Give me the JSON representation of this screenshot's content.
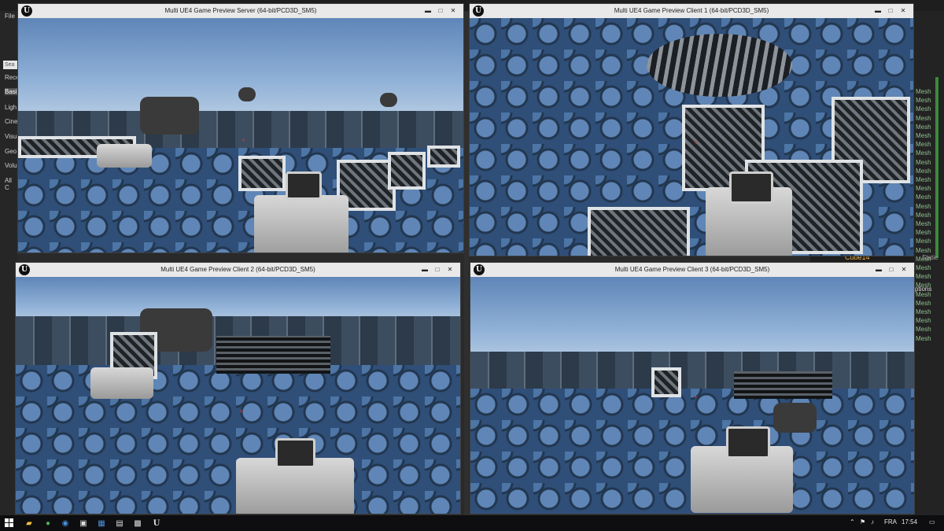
{
  "editor": {
    "menu_file": "File",
    "search_placeholder": "Sea",
    "left_categories": [
      "Rece",
      "Basi",
      "Ligh",
      "Cine",
      "Visu",
      "Geo",
      "Volu",
      "All C"
    ],
    "selected_category": "Basi",
    "right_items": [
      "Mesh",
      "Mesh",
      "Mesh",
      "Mesh",
      "Mesh",
      "Mesh",
      "Mesh",
      "Mesh",
      "Mesh",
      "Mesh",
      "Mesh",
      "Mesh",
      "Mesh",
      "Mesh",
      "Mesh",
      "Mesh",
      "Mesh",
      "Mesh",
      "Mesh",
      "Mesh",
      "Mesh",
      "Mesh",
      "Mesh",
      "Mesh",
      "Mesh",
      "Mesh",
      "Mesh",
      "Mesh",
      "Mesh"
    ],
    "outliner_row_name": "Cube14",
    "outliner_row_type": "Static",
    "options_label": "ptions"
  },
  "windows": {
    "server": {
      "title": "Multi UE4 Game Preview Server (64-bit/PCD3D_SM5)"
    },
    "client1": {
      "title": "Multi UE4 Game Preview Client 1 (64-bit/PCD3D_SM5)"
    },
    "client2": {
      "title": "Multi UE4 Game Preview Client 2 (64-bit/PCD3D_SM5)"
    },
    "client3": {
      "title": "Multi UE4 Game Preview Client 3 (64-bit/PCD3D_SM5)"
    },
    "buttons": {
      "minimize": "▬",
      "maximize": "□",
      "close": "✕"
    },
    "logo": "U"
  },
  "taskbar": {
    "icons": [
      "windows-start-icon",
      "file-explorer-icon",
      "chrome-icon",
      "edge-icon",
      "app-icon",
      "store-icon",
      "folder-icon",
      "epic-icon",
      "unreal-icon"
    ],
    "language": "FRA",
    "time": "17:54"
  },
  "colors": {
    "sky": "#8fb0d6",
    "floor": "#2f4f78",
    "crosshair": "#e23030",
    "titlebar": "#e9e9e9"
  }
}
